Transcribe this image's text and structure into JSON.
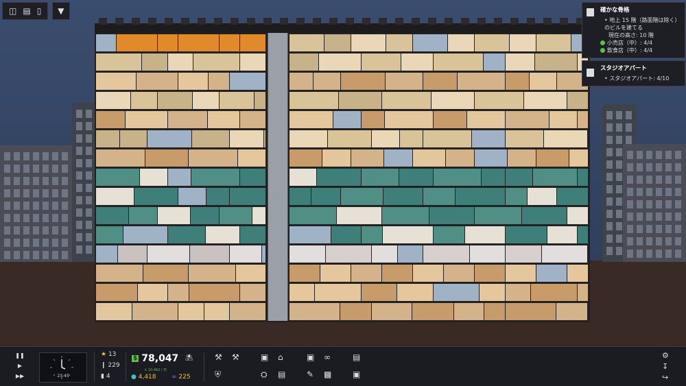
{
  "toolbar": {
    "buttons": [
      {
        "icon": "windows-icon"
      },
      {
        "icon": "chart-icon"
      },
      {
        "icon": "book-icon"
      }
    ],
    "dropdown_icon": "chevron-down-icon"
  },
  "goal_panel_1": {
    "title": "確かな骨格",
    "bullet": "地上 15 階（路面階は除く）のビルを建てる",
    "current_height": "現在の高さ: 10 階",
    "checks": [
      "小売店（中）: 4/4",
      "飲食店（中）: 4/4"
    ]
  },
  "goal_panel_2": {
    "title": "スタジオアパート",
    "bullet": "スタジオアパート: 4/10"
  },
  "clock": {
    "time": "23:45"
  },
  "stats": {
    "stars": "13",
    "population": "229",
    "workers": "4"
  },
  "money": {
    "amount": "78,047",
    "rate": "+ 10,462 / 日",
    "research": "4,418",
    "influence": "225"
  },
  "colors": {
    "money_green": "#5ec24a",
    "research_teal": "#3fc3c9",
    "influence_purple": "#9a6cf0",
    "star_yellow": "#f2c230",
    "research_text": "#f2c230",
    "influence_text": "#f2c230"
  }
}
